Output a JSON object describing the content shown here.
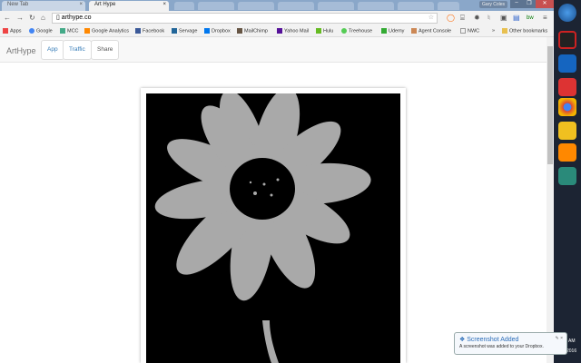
{
  "browser": {
    "tabs": [
      {
        "label": "New Tab"
      },
      {
        "label": "Art Hype"
      }
    ],
    "user": "Gary Coles",
    "url": "arthype.co"
  },
  "bookmarks": [
    "Apps",
    "Google",
    "MCC",
    "Google Analytics",
    "Facebook",
    "Servage",
    "Dropbox",
    "MailChimp",
    "Yahoo Mail",
    "Hulu",
    "Treehouse",
    "Udemy",
    "Agent Console",
    "NWC",
    "Other bookmarks"
  ],
  "app": {
    "brand": "ArtHype",
    "nav": [
      "App",
      "Traffic",
      "Share"
    ]
  },
  "toast": {
    "title": "Screenshot Added",
    "message": "A screenshot was added to your Dropbox."
  },
  "clock": {
    "ampm": "AM",
    "year": "2016"
  },
  "colors": {
    "flower": "#a9a9a9",
    "link": "#337ab7"
  }
}
